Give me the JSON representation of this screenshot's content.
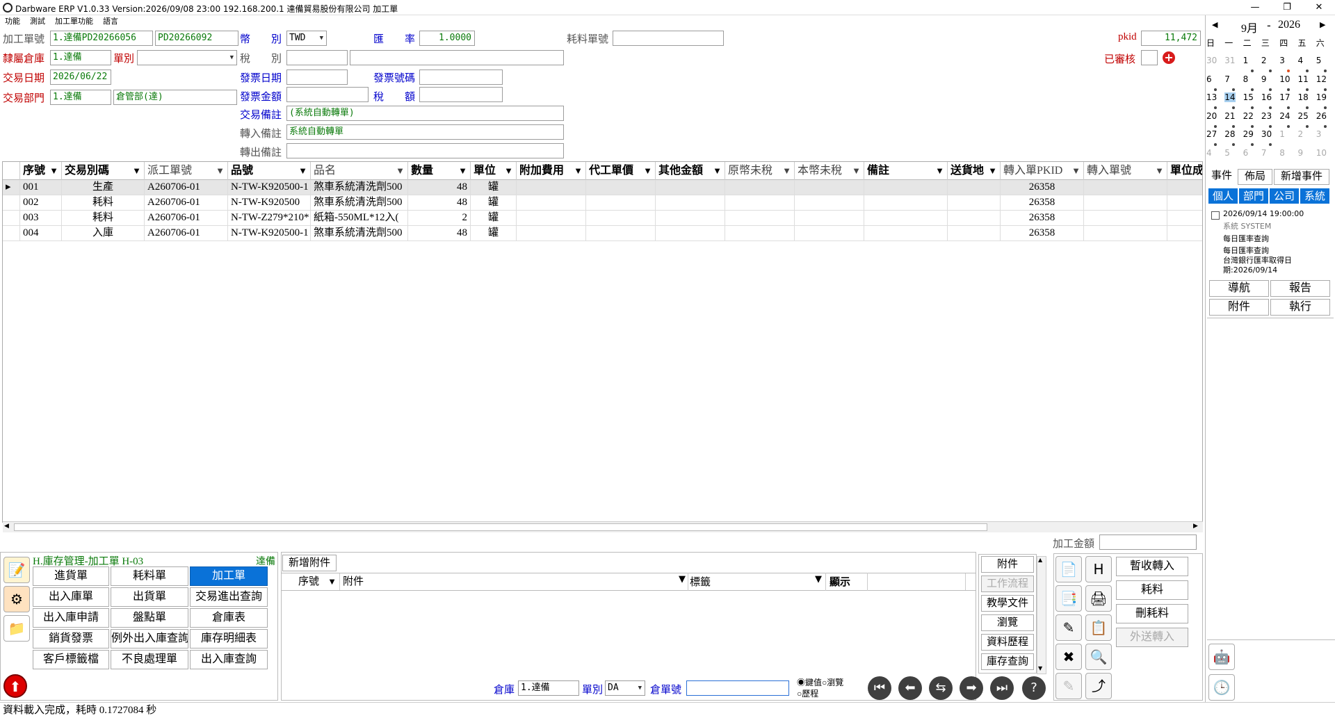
{
  "window": {
    "title": "Darbware ERP V1.0.33 Version:2026/09/08 23:00   192.168.200.1 達備貿易股份有限公司 加工單",
    "min": "—",
    "max": "❐",
    "close": "✕"
  },
  "menu": [
    "功能",
    "測試",
    "加工單功能",
    "語言"
  ],
  "form": {
    "order_no_label": "加工單號",
    "order_no_prefix": "1.達備PD20266056",
    "order_no": "PD20266092",
    "currency_label": "幣　　別",
    "currency": "TWD",
    "rate_label": "匯　　率",
    "rate": "1.0000",
    "consume_no_label": "耗料單號",
    "consume_no": "",
    "pkid_label": "pkid",
    "pkid": "11,472",
    "warehouse_label": "隸屬倉庫",
    "warehouse": "1.達備",
    "doc_type_label": "單別",
    "doc_type": "",
    "tax_type_label": "稅　　別",
    "tax_type": "",
    "tax_desc": "",
    "approved_label": "已審核",
    "trade_date_label": "交易日期",
    "trade_date": "2026/06/22",
    "invoice_date_label": "發票日期",
    "invoice_date": "",
    "invoice_no_label": "發票號碼",
    "invoice_no": "",
    "dept_label": "交易部門",
    "dept_code": "1.達備",
    "dept_name": "倉管部(達)",
    "invoice_amt_label": "發票金額",
    "invoice_amt": "",
    "tax_amt_label": "稅　　額",
    "tax_amt": "",
    "trade_note_label": "交易備註",
    "trade_note": "(系統自動轉單)",
    "in_note_label": "轉入備註",
    "in_note": "系統自動轉單",
    "out_note_label": "轉出備註",
    "out_note": ""
  },
  "grid": {
    "columns": [
      "序號",
      "交易別碼",
      "派工單號",
      "品號",
      "品名",
      "數量",
      "單位",
      "附加費用",
      "代工單價",
      "其他金額",
      "原幣未稅",
      "本幣未稅",
      "備註",
      "送貨地",
      "轉入單PKID",
      "轉入單號",
      "單位成"
    ],
    "rows": [
      [
        "001",
        "生產",
        "A260706-01",
        "N-TW-K920500-1",
        "煞車系統清洗劑500",
        "48",
        "罐",
        "",
        "",
        "",
        "",
        "",
        "",
        "",
        "26358",
        "",
        ""
      ],
      [
        "002",
        "耗料",
        "A260706-01",
        "N-TW-K920500",
        "煞車系統清洗劑500",
        "48",
        "罐",
        "",
        "",
        "",
        "",
        "",
        "",
        "",
        "26358",
        "",
        ""
      ],
      [
        "003",
        "耗料",
        "A260706-01",
        "N-TW-Z279*210*",
        "紙箱-550ML*12入(",
        "2",
        "罐",
        "",
        "",
        "",
        "",
        "",
        "",
        "",
        "26358",
        "",
        ""
      ],
      [
        "004",
        "入庫",
        "A260706-01",
        "N-TW-K920500-1",
        "煞車系統清洗劑500",
        "48",
        "罐",
        "",
        "",
        "",
        "",
        "",
        "",
        "",
        "26358",
        "",
        ""
      ]
    ],
    "total_label": "加工金額",
    "total": ""
  },
  "module": {
    "title": "H.庫存管理-加工單 H-03",
    "company": "達備",
    "buttons": [
      [
        "進貨單",
        "耗料單",
        "加工單"
      ],
      [
        "出入庫單",
        "出貨單",
        "交易進出查詢"
      ],
      [
        "出入庫申請",
        "盤點單",
        "倉庫表"
      ],
      [
        "銷貨發票",
        "例外出入庫查詢",
        "庫存明細表"
      ],
      [
        "客戶標籤檔",
        "不良處理單",
        "出入庫查詢"
      ]
    ]
  },
  "attach": {
    "add_button": "新增附件",
    "columns": [
      "序號",
      "附件",
      "標籤",
      "顯示"
    ],
    "side_buttons": [
      "附件",
      "工作流程",
      "教學文件",
      "瀏覽",
      "資料歷程",
      "庫存查詢"
    ]
  },
  "nav": {
    "warehouse_label": "倉庫",
    "warehouse": "1.達備",
    "doc_type_label": "單別",
    "doc_type": "DA",
    "doc_no_label": "倉單號",
    "doc_no": "",
    "radio": [
      "鍵值",
      "瀏覽",
      "歷程"
    ],
    "icons": [
      "first-icon",
      "prev-icon",
      "refresh-icon",
      "next-icon",
      "last-icon",
      "help-icon"
    ]
  },
  "right_actions": [
    "暫收轉入",
    "耗料",
    "刪耗料",
    "外送轉入"
  ],
  "calendar": {
    "month": "9月",
    "year": "2026",
    "weekdays": [
      "日",
      "一",
      "二",
      "三",
      "四",
      "五",
      "六"
    ],
    "weeks": [
      [
        "30",
        "31",
        "1",
        "2",
        "3",
        "4",
        "5"
      ],
      [
        "6",
        "7",
        "8",
        "9",
        "10",
        "11",
        "12"
      ],
      [
        "13",
        "14",
        "15",
        "16",
        "17",
        "18",
        "19"
      ],
      [
        "20",
        "21",
        "22",
        "23",
        "24",
        "25",
        "26"
      ],
      [
        "27",
        "28",
        "29",
        "30",
        "1",
        "2",
        "3"
      ],
      [
        "4",
        "5",
        "6",
        "7",
        "8",
        "9",
        "10"
      ]
    ],
    "today": "14"
  },
  "events": {
    "tabs": [
      "事件",
      "佈局",
      "新增事件"
    ],
    "scopes": [
      "個人",
      "部門",
      "公司",
      "系統"
    ],
    "item_time": "2026/09/14 19:00:00",
    "item_source": "系統  SYSTEM",
    "item_lines": [
      "每日匯率查詢",
      "每日匯率查詢",
      "台灣銀行匯率取得日",
      "期:2026/09/14"
    ],
    "buttons": [
      "導航",
      "報告",
      "附件",
      "執行"
    ]
  },
  "status": "資料載入完成，耗時 0.1727084 秒",
  "colors": {
    "accent": "#0a72d8",
    "label_red": "#c00000",
    "label_blue": "#0000cc",
    "value_green": "#0a7a0a"
  }
}
